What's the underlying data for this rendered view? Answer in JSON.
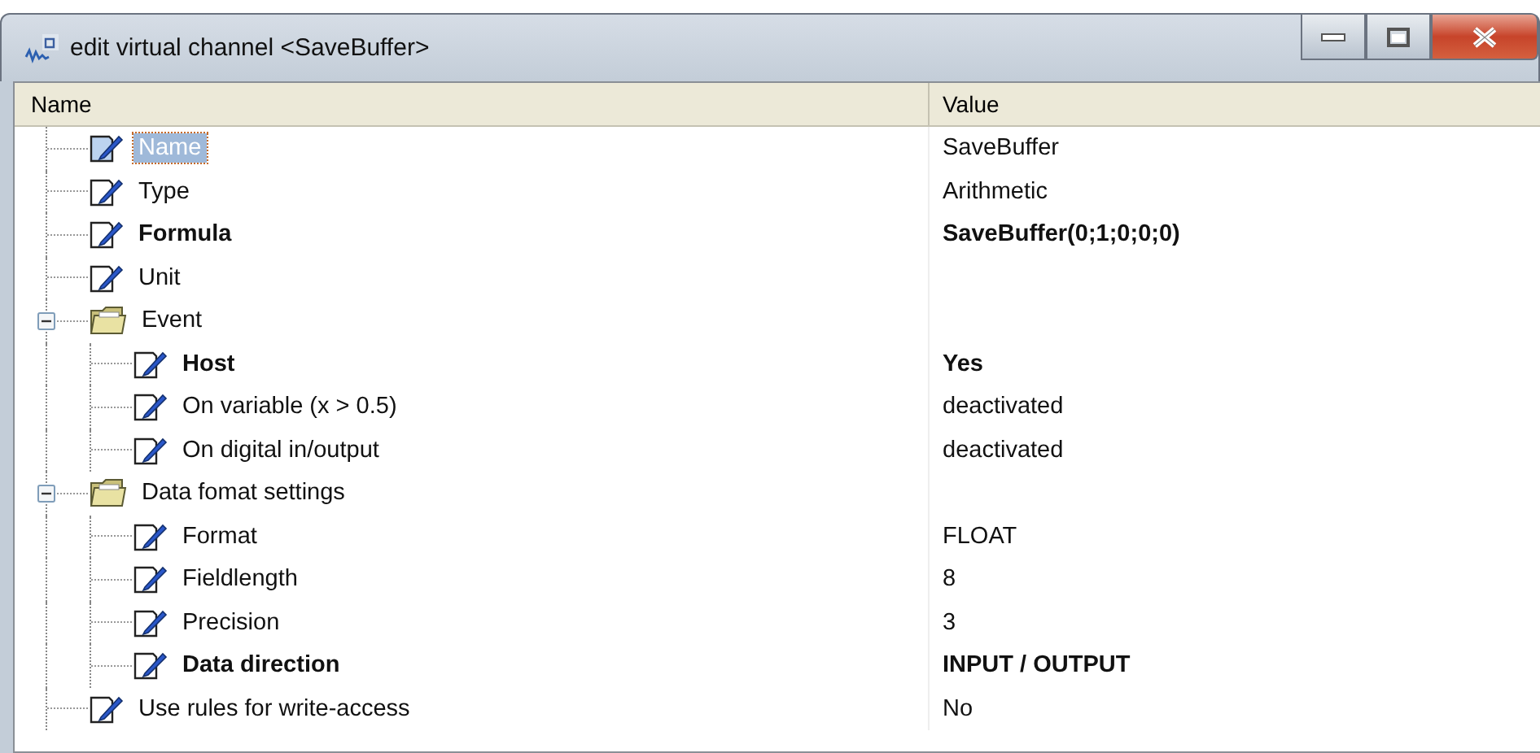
{
  "window": {
    "title": "edit virtual channel <SaveBuffer>"
  },
  "columns": [
    "Name",
    "Value"
  ],
  "tree": [
    {
      "kind": "property",
      "label": "Name",
      "value": "SaveBuffer",
      "bold": false,
      "selected": true
    },
    {
      "kind": "property",
      "label": "Type",
      "value": "Arithmetic",
      "bold": false,
      "selected": false
    },
    {
      "kind": "property",
      "label": "Formula",
      "value": "SaveBuffer(0;1;0;0;0)",
      "bold": true,
      "selected": false
    },
    {
      "kind": "property",
      "label": "Unit",
      "bold": false,
      "selected": false
    },
    {
      "kind": "group",
      "label": "Event",
      "expanded": true,
      "selected": false,
      "children": [
        {
          "kind": "property",
          "label": "Host",
          "value": "Yes",
          "bold": true,
          "selected": false
        },
        {
          "kind": "property",
          "label": "On variable (x > 0.5)",
          "value": "deactivated",
          "bold": false,
          "selected": false
        },
        {
          "kind": "property",
          "label": "On digital in/output",
          "value": "deactivated",
          "bold": false,
          "selected": false
        }
      ]
    },
    {
      "kind": "group",
      "label": "Data fomat settings",
      "expanded": true,
      "selected": false,
      "children": [
        {
          "kind": "property",
          "label": "Format",
          "value": "FLOAT",
          "bold": false,
          "selected": false
        },
        {
          "kind": "property",
          "label": "Fieldlength",
          "value": "8",
          "bold": false,
          "selected": false
        },
        {
          "kind": "property",
          "label": "Precision",
          "value": "3",
          "bold": false,
          "selected": false
        },
        {
          "kind": "property",
          "label": "Data direction",
          "value": "INPUT / OUTPUT",
          "bold": true,
          "selected": false
        }
      ]
    },
    {
      "kind": "property",
      "label": "Use rules for write-access",
      "value": "No",
      "bold": false,
      "selected": false
    }
  ]
}
